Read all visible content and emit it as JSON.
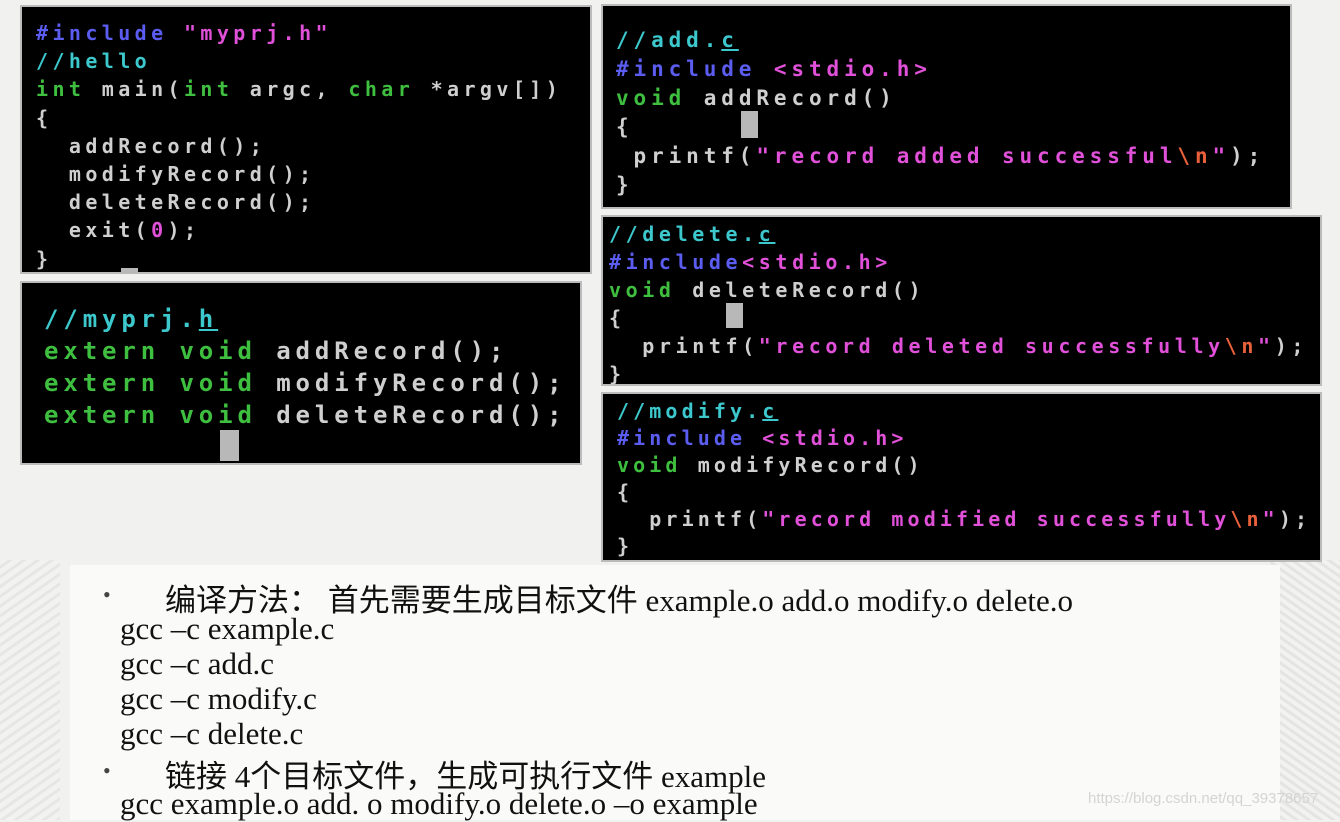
{
  "colors": {
    "include": "#5b5cf0",
    "string": "#e050d8",
    "comment": "#3cc8cc",
    "type": "#3fbf3f",
    "text": "#cfcfcf"
  },
  "panels": [
    {
      "name": "example-c",
      "lines": [
        [
          [
            "#include ",
            "inc"
          ],
          [
            "\"myprj.h\"",
            "str"
          ]
        ],
        [
          [
            "//hello",
            "cmt"
          ]
        ],
        [
          [
            "int",
            "type"
          ],
          [
            " main(",
            "txt"
          ],
          [
            "int",
            "type"
          ],
          [
            " argc, ",
            "txt"
          ],
          [
            "char",
            "type"
          ],
          [
            " *argv[])",
            "txt"
          ]
        ],
        [
          [
            "{",
            "txt"
          ]
        ],
        [
          [
            "  addRecord();",
            "txt"
          ]
        ],
        [
          [
            "  modifyRecord();",
            "txt"
          ]
        ],
        [
          [
            "  deleteRecord();",
            "txt"
          ]
        ],
        [
          [
            "  exit(",
            "txt"
          ],
          [
            "0",
            "str"
          ],
          [
            ");",
            "txt"
          ]
        ],
        [
          [
            "}",
            "txt"
          ]
        ]
      ]
    },
    {
      "name": "myprj-h",
      "lines": [
        [
          [
            "//myprj.",
            "cmt"
          ],
          [
            "h",
            "cmt u"
          ]
        ],
        [
          [
            "extern void",
            "type"
          ],
          [
            " addRecord();",
            "txt"
          ]
        ],
        [
          [
            "extern void",
            "type"
          ],
          [
            " modifyRecord();",
            "txt"
          ]
        ],
        [
          [
            "extern void",
            "type"
          ],
          [
            " deleteRecord();",
            "txt"
          ]
        ]
      ]
    },
    {
      "name": "add-c",
      "lines": [
        [
          [
            "//add.",
            "cmt"
          ],
          [
            "c",
            "cmt u"
          ]
        ],
        [
          [
            "#include ",
            "inc"
          ],
          [
            "<stdio.h>",
            "str"
          ]
        ],
        [
          [
            "void",
            "type"
          ],
          [
            " addRecord()",
            "txt"
          ]
        ],
        [
          [
            "{",
            "txt"
          ]
        ],
        [
          [
            " printf(",
            "txt"
          ],
          [
            "\"record added successful",
            "str"
          ],
          [
            "\\n",
            "esc"
          ],
          [
            "\"",
            "str"
          ],
          [
            ");",
            "txt"
          ]
        ],
        [
          [
            "}",
            "txt"
          ]
        ]
      ]
    },
    {
      "name": "delete-c",
      "lines": [
        [
          [
            "//delete.",
            "cmt"
          ],
          [
            "c",
            "cmt u"
          ]
        ],
        [
          [
            "#include",
            "inc"
          ],
          [
            "<stdio.h>",
            "str"
          ]
        ],
        [
          [
            "void",
            "type"
          ],
          [
            " deleteRecord()",
            "txt"
          ]
        ],
        [
          [
            "{",
            "txt"
          ]
        ],
        [
          [
            "  printf(",
            "txt"
          ],
          [
            "\"record deleted successfully",
            "str"
          ],
          [
            "\\n",
            "esc"
          ],
          [
            "\"",
            "str"
          ],
          [
            ");",
            "txt"
          ]
        ],
        [
          [
            "}",
            "txt"
          ]
        ]
      ]
    },
    {
      "name": "modify-c",
      "lines": [
        [
          [
            "//modify.",
            "cmt"
          ],
          [
            "c",
            "cmt u"
          ]
        ],
        [
          [
            "#include ",
            "inc"
          ],
          [
            "<stdio.h>",
            "str"
          ]
        ],
        [
          [
            "void",
            "type"
          ],
          [
            " modifyRecord()",
            "txt"
          ]
        ],
        [
          [
            "{",
            "txt"
          ]
        ],
        [
          [
            "  printf(",
            "txt"
          ],
          [
            "\"record modified successfully",
            "str"
          ],
          [
            "\\n",
            "esc"
          ],
          [
            "\"",
            "str"
          ],
          [
            ");",
            "txt"
          ]
        ],
        [
          [
            "}",
            "txt"
          ]
        ]
      ]
    }
  ],
  "notes": {
    "bullet1": "编译方法： 首先需要生成目标文件 example.o add.o modify.o delete.o",
    "cmd1": "gcc –c example.c",
    "cmd2": "gcc –c add.c",
    "cmd3": "gcc –c modify.c",
    "cmd4": "gcc –c delete.c",
    "bullet2": "链接 4个目标文件，生成可执行文件 example",
    "cmd5": "gcc example.o add. o modify.o delete.o –o example",
    "bullet_char": "•"
  },
  "watermark": "https://blog.csdn.net/qq_39378657"
}
